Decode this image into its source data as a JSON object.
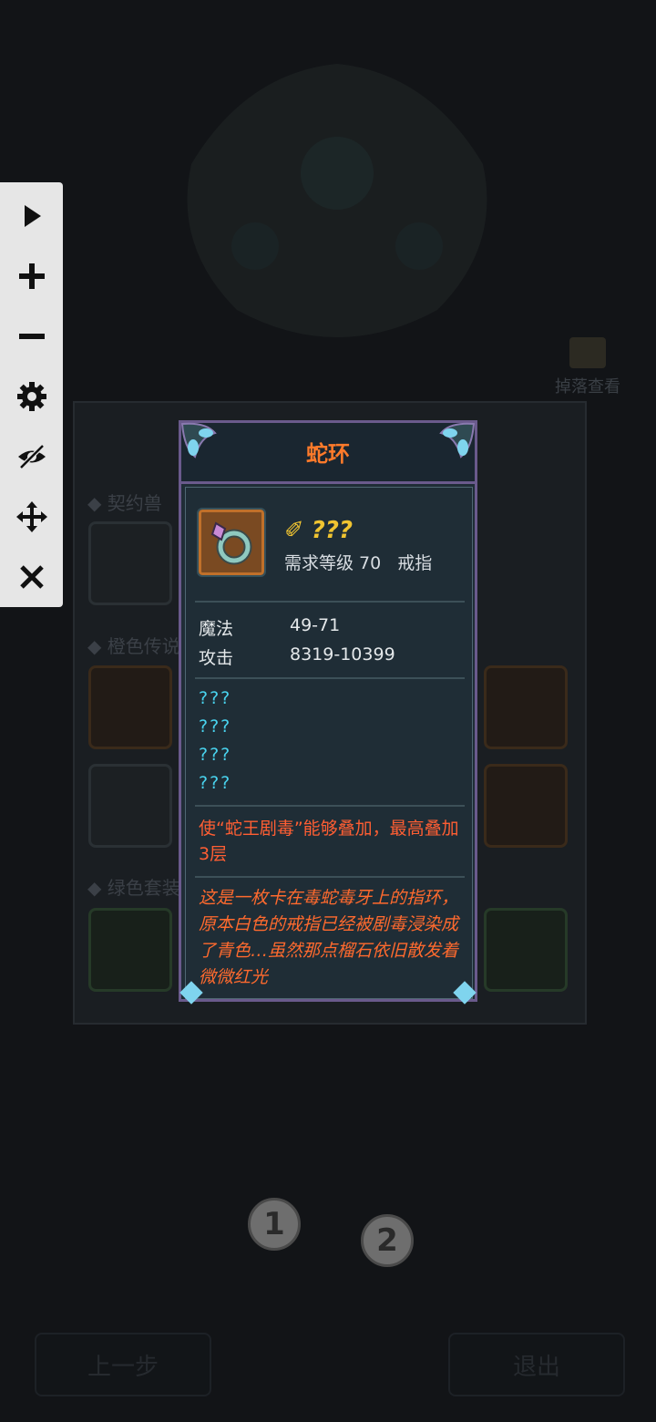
{
  "background": {
    "drop_view_label": "掉落查看",
    "sections": [
      "契约兽",
      "橙色传说",
      "绿色套装"
    ],
    "step_markers": [
      "1",
      "2"
    ],
    "bottom_buttons": {
      "prev": "上一步",
      "exit": "退出"
    }
  },
  "toolbar": {
    "items": [
      {
        "icon": "play-icon"
      },
      {
        "icon": "plus-icon"
      },
      {
        "icon": "minus-icon"
      },
      {
        "icon": "gear-icon"
      },
      {
        "icon": "eye-off-icon"
      },
      {
        "icon": "move-icon"
      },
      {
        "icon": "close-icon"
      }
    ]
  },
  "item_card": {
    "title": "蛇环",
    "quality_name": "???",
    "quality_color": "#f0c431",
    "requirement": "需求等级 70",
    "item_type": "戒指",
    "stats": [
      {
        "label": "魔法",
        "value": "49-71"
      },
      {
        "label": "攻击",
        "value": "8319-10399"
      }
    ],
    "unknown_affixes": [
      "???",
      "???",
      "???",
      "???"
    ],
    "effect_text": "使“蛇王剧毒”能够叠加，最高叠加3层",
    "lore_text": "这是一枚卡在毒蛇毒牙上的指环，原本白色的戒指已经被剧毒浸染成了青色…虽然那点榴石依旧散发着微微红光",
    "colors": {
      "title": "#ff7a2a",
      "affix_unknown": "#49d3ee",
      "effect": "#ff5e33",
      "lore": "#ff6a2e",
      "frame": "#6a5a8c"
    }
  }
}
